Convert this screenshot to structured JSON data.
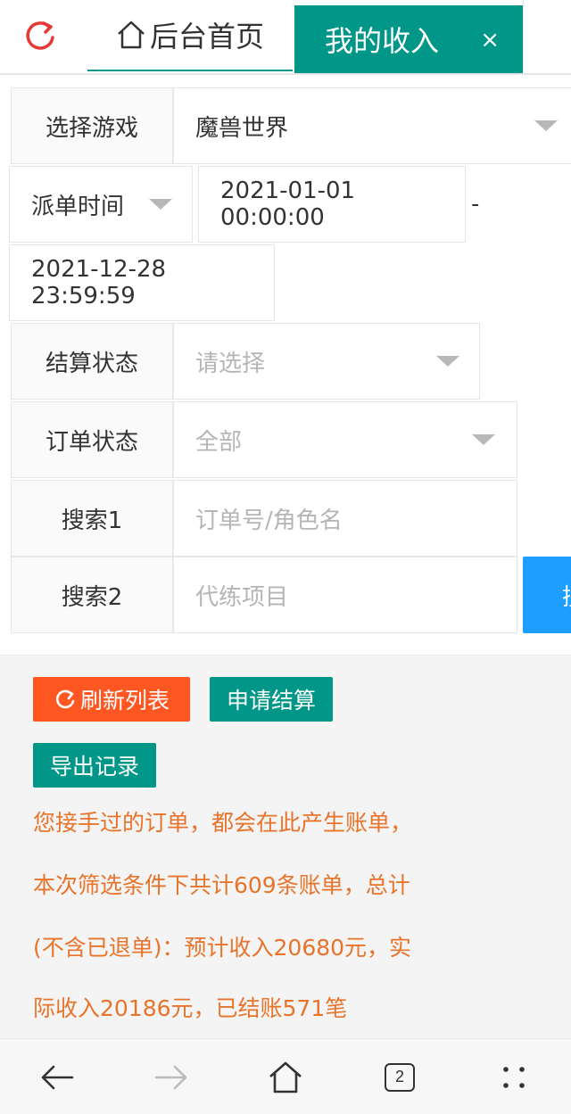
{
  "tabs": {
    "home_label": "后台首页",
    "active_label": "我的收入",
    "close_glyph": "×"
  },
  "form": {
    "game": {
      "label": "选择游戏",
      "value": "魔兽世界"
    },
    "time": {
      "label": "派单时间",
      "start": "2021-01-01 00:00:00",
      "separator": "-",
      "end": "2021-12-28 23:59:59"
    },
    "settle_status": {
      "label": "结算状态",
      "placeholder": "请选择"
    },
    "order_status": {
      "label": "订单状态",
      "value": "全部"
    },
    "search1": {
      "label": "搜索1",
      "placeholder": "订单号/角色名"
    },
    "search2": {
      "label": "搜索2",
      "placeholder": "代练项目"
    },
    "search_button_label": "搜"
  },
  "actions": {
    "refresh_label": "刷新列表",
    "settle_label": "申请结算",
    "export_label": "导出记录"
  },
  "notice": {
    "line1": "您接手过的订单，都会在此产生账单，",
    "line2": "本次筛选条件下共计609条账单，总计",
    "line3": "(不含已退单)：预计收入20680元，实",
    "line4": "际收入20186元，已结账571笔"
  },
  "browser": {
    "tab_count": "2"
  },
  "colors": {
    "primary": "#009688",
    "warm": "#ff5722",
    "blue": "#1e9fff",
    "notice_text": "#e8742b",
    "refresh_icon": "#e53935"
  },
  "icons": [
    "refresh-icon",
    "home-icon",
    "close-icon",
    "chevron-down-icon",
    "back-arrow-icon",
    "forward-arrow-icon",
    "tabs-icon",
    "more-icon"
  ]
}
